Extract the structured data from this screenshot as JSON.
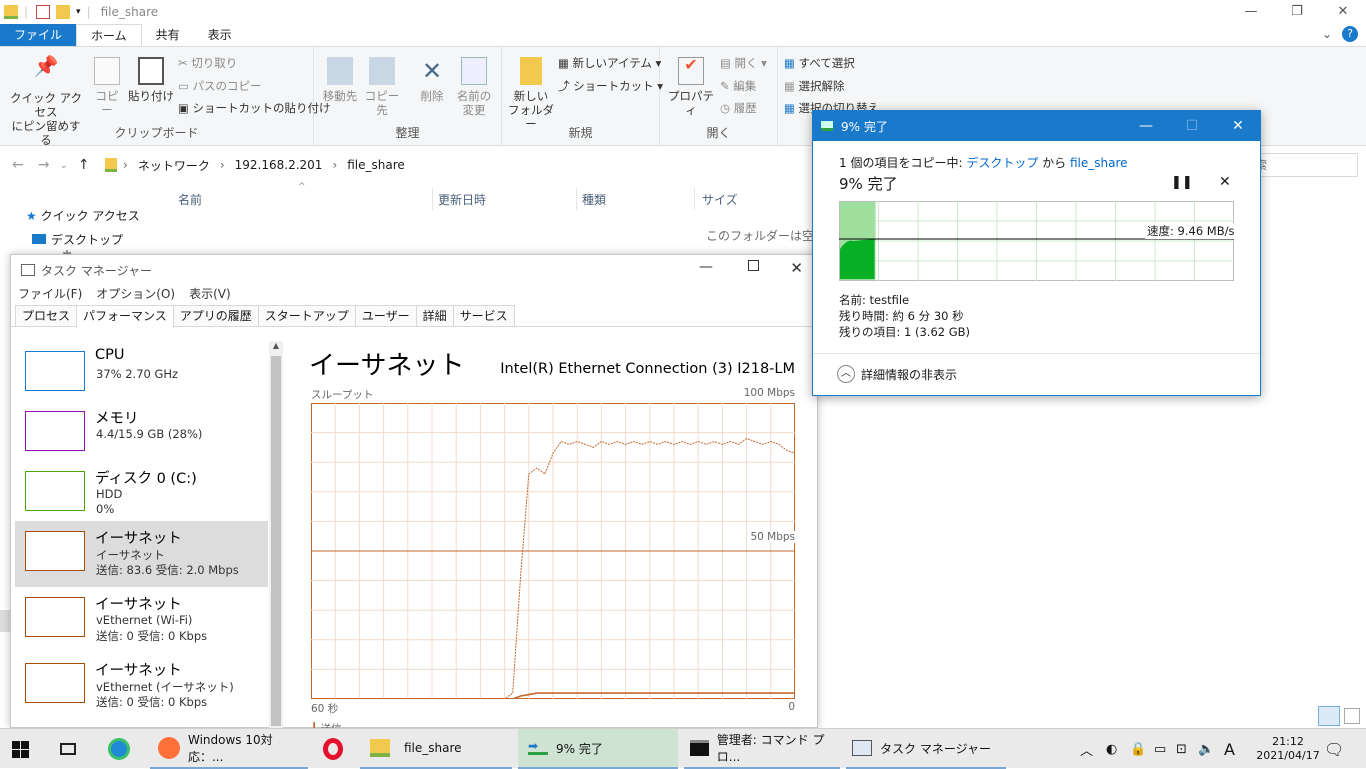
{
  "explorer": {
    "window_title": "file_share",
    "ribbon_tabs": [
      "ファイル",
      "ホーム",
      "共有",
      "表示"
    ],
    "clipboard": {
      "pin_line1": "クイック アクセス",
      "pin_line2": "にピン留めする",
      "copy": "コピー",
      "paste": "貼り付け",
      "cut": "切り取り",
      "copy_path": "パスのコピー",
      "paste_shortcut": "ショートカットの貼り付け",
      "group": "クリップボード"
    },
    "organize": {
      "move_to": "移動先",
      "copy_to": "コピー先",
      "delete": "削除",
      "rename_line1": "名前の",
      "rename_line2": "変更",
      "group": "整理"
    },
    "new": {
      "new_folder_line1": "新しい",
      "new_folder_line2": "フォルダー",
      "new_item": "新しいアイテム",
      "shortcut": "ショートカット",
      "group": "新規"
    },
    "open": {
      "properties": "プロパティ",
      "open": "開く",
      "edit": "編集",
      "history": "履歴",
      "group": "開く"
    },
    "select": {
      "select_all": "すべて選択",
      "select_none": "選択解除",
      "invert": "選択の切り替え"
    },
    "breadcrumb": [
      "ネットワーク",
      "192.168.2.201",
      "file_share"
    ],
    "search_placeholder": "索",
    "nav": {
      "quick_access": "クイック アクセス",
      "desktop": "デスクトップ"
    },
    "columns": [
      "名前",
      "更新日時",
      "種類",
      "サイズ"
    ],
    "empty_message": "このフォルダーは空です。"
  },
  "taskmgr": {
    "title": "タスク マネージャー",
    "menu": [
      "ファイル(F)",
      "オプション(O)",
      "表示(V)"
    ],
    "tabs": [
      "プロセス",
      "パフォーマンス",
      "アプリの履歴",
      "スタートアップ",
      "ユーザー",
      "詳細",
      "サービス"
    ],
    "active_tab": "パフォーマンス",
    "resources": [
      {
        "name": "CPU",
        "line1": "37%  2.70 GHz",
        "line2": "",
        "color": "#1979ca"
      },
      {
        "name": "メモリ",
        "line1": "4.4/15.9 GB (28%)",
        "line2": "",
        "color": "#8b12ae"
      },
      {
        "name": "ディスク 0 (C:)",
        "line1": "HDD",
        "line2": "0%",
        "color": "#4da60c"
      },
      {
        "name": "イーサネット",
        "line1": "イーサネット",
        "line2": "送信: 83.6  受信: 2.0 Mbps",
        "color": "#a74f01"
      },
      {
        "name": "イーサネット",
        "line1": "vEthernet (Wi-Fi)",
        "line2": "送信: 0  受信: 0 Kbps",
        "color": "#a74f01"
      },
      {
        "name": "イーサネット",
        "line1": "vEthernet (イーサネット)",
        "line2": "送信: 0  受信: 0 Kbps",
        "color": "#a74f01"
      }
    ],
    "detail": {
      "heading": "イーサネット",
      "adapter": "Intel(R) Ethernet Connection (3) I218-LM",
      "graph_label": "スループット",
      "max_label": "100 Mbps",
      "mid_label": "50 Mbps",
      "x_left": "60 秒",
      "x_right": "0",
      "legend_cut": "送信"
    }
  },
  "chart_data": {
    "type": "line",
    "title": "スループット",
    "xlabel": "",
    "ylabel": "",
    "ylim": [
      0,
      100
    ],
    "x": [
      60,
      57,
      54,
      51,
      48,
      45,
      42,
      39,
      36,
      35,
      34,
      33,
      32,
      31,
      30,
      29,
      28,
      27,
      26,
      25,
      24,
      23,
      22,
      21,
      20,
      19,
      18,
      17,
      16,
      15,
      14,
      13,
      12,
      11,
      10,
      9,
      8,
      7,
      6,
      5,
      4,
      3,
      2,
      1,
      0
    ],
    "series": [
      {
        "name": "送信",
        "values": [
          0,
          0,
          0,
          0,
          0,
          0,
          0,
          0,
          0,
          2,
          42,
          76,
          78,
          76,
          83,
          87,
          86,
          87,
          86,
          85,
          87,
          86,
          87,
          86,
          87,
          86,
          87,
          86,
          87,
          86,
          87,
          86,
          87,
          86,
          87,
          86,
          87,
          86,
          88,
          87,
          86,
          87,
          86,
          84,
          83
        ]
      },
      {
        "name": "受信",
        "values": [
          0,
          0,
          0,
          0,
          0,
          0,
          0,
          0,
          0,
          0,
          1,
          1.5,
          2,
          2,
          2,
          2,
          2,
          2,
          2,
          2,
          2,
          2,
          2,
          2,
          2,
          2,
          2,
          2,
          2,
          2,
          2,
          2,
          2,
          2,
          2,
          2,
          2,
          2,
          2,
          2,
          2,
          2,
          2,
          2,
          2
        ]
      }
    ],
    "grid": true,
    "colors": {
      "line": "#c3672c",
      "grid": "#f1dacb",
      "border": "#c3672c"
    }
  },
  "copy_dialog": {
    "title": "9% 完了",
    "desc_prefix": "1 個の項目をコピー中: ",
    "source": "デスクトップ",
    "from": " から ",
    "dest": "file_share",
    "percent_text": "9% 完了",
    "progress": 0.09,
    "speed": "速度: 9.46 MB/s",
    "name": "名前:  testfile",
    "remaining_time": "残り時間:  約 6 分 30 秒",
    "remaining_items": "残りの項目:  1 (3.62 GB)",
    "toggle": "詳細情報の非表示",
    "pause_glyph": "⏸",
    "close_glyph": "✕"
  },
  "taskbar": {
    "items": [
      {
        "label": "Windows 10対応：..."
      },
      {
        "label": "file_share"
      },
      {
        "label": "9% 完了"
      },
      {
        "label": "管理者: コマンド プロ..."
      },
      {
        "label": "タスク マネージャー"
      }
    ],
    "time": "21:12",
    "date": "2021/04/17",
    "ime": "A"
  }
}
